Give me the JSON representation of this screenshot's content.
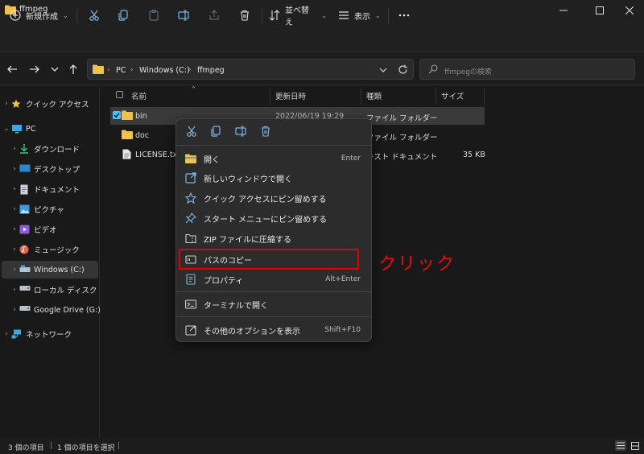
{
  "window": {
    "title": "ffmpeg"
  },
  "toolbar": {
    "new_label": "新規作成",
    "sort_label": "並べ替え",
    "view_label": "表示"
  },
  "address": {
    "segments": [
      "PC",
      "Windows (C:)",
      "ffmpeg"
    ]
  },
  "search": {
    "placeholder": "ffmpegの検索"
  },
  "nav": {
    "items": [
      {
        "label": "クイック アクセス"
      },
      {
        "label": "PC"
      },
      {
        "label": "ダウンロード"
      },
      {
        "label": "デスクトップ"
      },
      {
        "label": "ドキュメント"
      },
      {
        "label": "ピクチャ"
      },
      {
        "label": "ビデオ"
      },
      {
        "label": "ミュージック"
      },
      {
        "label": "Windows (C:)"
      },
      {
        "label": "ローカル ディスク (D:)"
      },
      {
        "label": "Google Drive (G:)"
      },
      {
        "label": "ネットワーク"
      }
    ]
  },
  "columns": {
    "name": "名前",
    "date": "更新日時",
    "type": "種類",
    "size": "サイズ"
  },
  "files": [
    {
      "name": "bin",
      "date": "2022/06/19 19:29",
      "type": "ファイル フォルダー",
      "size": ""
    },
    {
      "name": "doc",
      "date": "",
      "type": "ファイル フォルダー",
      "size": ""
    },
    {
      "name": "LICENSE.txt",
      "date": "",
      "type": "キスト ドキュメント",
      "size": "35 KB"
    }
  ],
  "context_menu": {
    "items": [
      {
        "label": "開く",
        "shortcut": "Enter"
      },
      {
        "label": "新しいウィンドウで開く",
        "shortcut": ""
      },
      {
        "label": "クイック アクセスにピン留めする",
        "shortcut": ""
      },
      {
        "label": "スタート メニューにピン留めする",
        "shortcut": ""
      },
      {
        "label": "ZIP ファイルに圧縮する",
        "shortcut": ""
      },
      {
        "label": "パスのコピー",
        "shortcut": ""
      },
      {
        "label": "プロパティ",
        "shortcut": "Alt+Enter"
      },
      {
        "label": "ターミナルで開く",
        "shortcut": ""
      },
      {
        "label": "その他のオプションを表示",
        "shortcut": "Shift+F10"
      }
    ]
  },
  "annotation": {
    "text": "クリック"
  },
  "status": {
    "item_count": "3 個の項目",
    "selected": "1 個の項目を選択"
  },
  "colors": {
    "accent": "#4cc2ff",
    "folder": "#f0c14b",
    "highlight": "#e00000"
  }
}
